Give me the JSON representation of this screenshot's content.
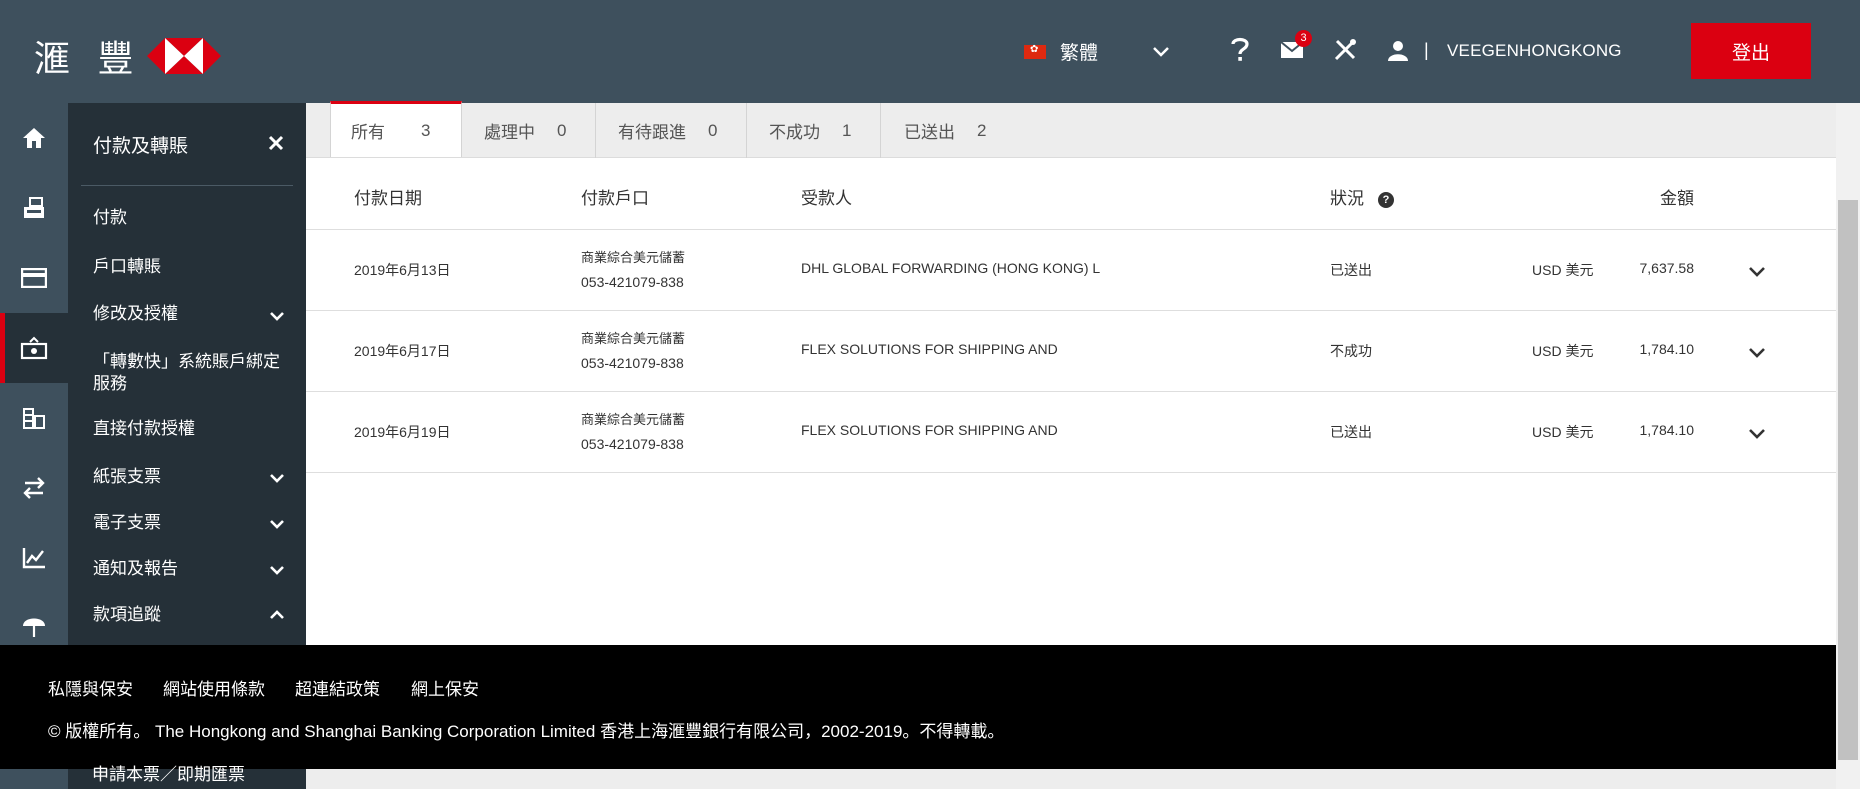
{
  "header": {
    "logo_text": "滙 豐",
    "language": "繁體",
    "notifications_count": "3",
    "username": "VEEGENHONGKONG",
    "logout_label": "登出",
    "separator": "|",
    "brand_red": "#db0011",
    "bar_color": "#3e505d"
  },
  "rail": {
    "icons": [
      "home-icon",
      "deposit-icon",
      "card-icon",
      "payment-icon",
      "coins-icon",
      "transfer-icon",
      "chart-icon",
      "umbrella-icon"
    ],
    "active_index": 3
  },
  "submenu": {
    "title": "付款及轉賬",
    "items": [
      {
        "label": "付款"
      },
      {
        "label": "戶口轉賬"
      },
      {
        "label": "修改及授權",
        "chevron": "down"
      },
      {
        "label": "「轉數快」系統賬戶綁定服務"
      },
      {
        "label": "直接付款授權"
      },
      {
        "label": "紙張支票",
        "chevron": "down"
      },
      {
        "label": "電子支票",
        "chevron": "down"
      },
      {
        "label": "通知及報告",
        "chevron": "down"
      },
      {
        "label": "款項追蹤",
        "chevron": "up"
      }
    ],
    "peek_item": "申請本票／即期匯票"
  },
  "tabs": [
    {
      "label": "所有",
      "count": "3",
      "active": true
    },
    {
      "label": "處理中",
      "count": "0"
    },
    {
      "label": "有待跟進",
      "count": "0"
    },
    {
      "label": "不成功",
      "count": "1"
    },
    {
      "label": "已送出",
      "count": "2"
    }
  ],
  "table": {
    "headers": {
      "date": "付款日期",
      "account": "付款戶口",
      "payee": "受款人",
      "status": "狀況",
      "amount": "金額"
    },
    "rows": [
      {
        "date": "2019年6月13日",
        "account_name": "商業綜合美元儲蓄",
        "account_no": "053-421079-838",
        "payee": "DHL GLOBAL FORWARDING (HONG KONG) L",
        "status": "已送出",
        "currency": "USD 美元",
        "amount": "7,637.58"
      },
      {
        "date": "2019年6月17日",
        "account_name": "商業綜合美元儲蓄",
        "account_no": "053-421079-838",
        "payee": "FLEX SOLUTIONS FOR SHIPPING AND",
        "status": "不成功",
        "currency": "USD 美元",
        "amount": "1,784.10"
      },
      {
        "date": "2019年6月19日",
        "account_name": "商業綜合美元儲蓄",
        "account_no": "053-421079-838",
        "payee": "FLEX SOLUTIONS FOR SHIPPING AND",
        "status": "已送出",
        "currency": "USD 美元",
        "amount": "1,784.10"
      }
    ]
  },
  "footer": {
    "links": [
      "私隱與保安",
      "網站使用條款",
      "超連結政策",
      "網上保安"
    ],
    "copyright": "© 版權所有。 The Hongkong and Shanghai Banking Corporation Limited 香港上海滙豐銀行有限公司，2002-2019。不得轉載。"
  }
}
